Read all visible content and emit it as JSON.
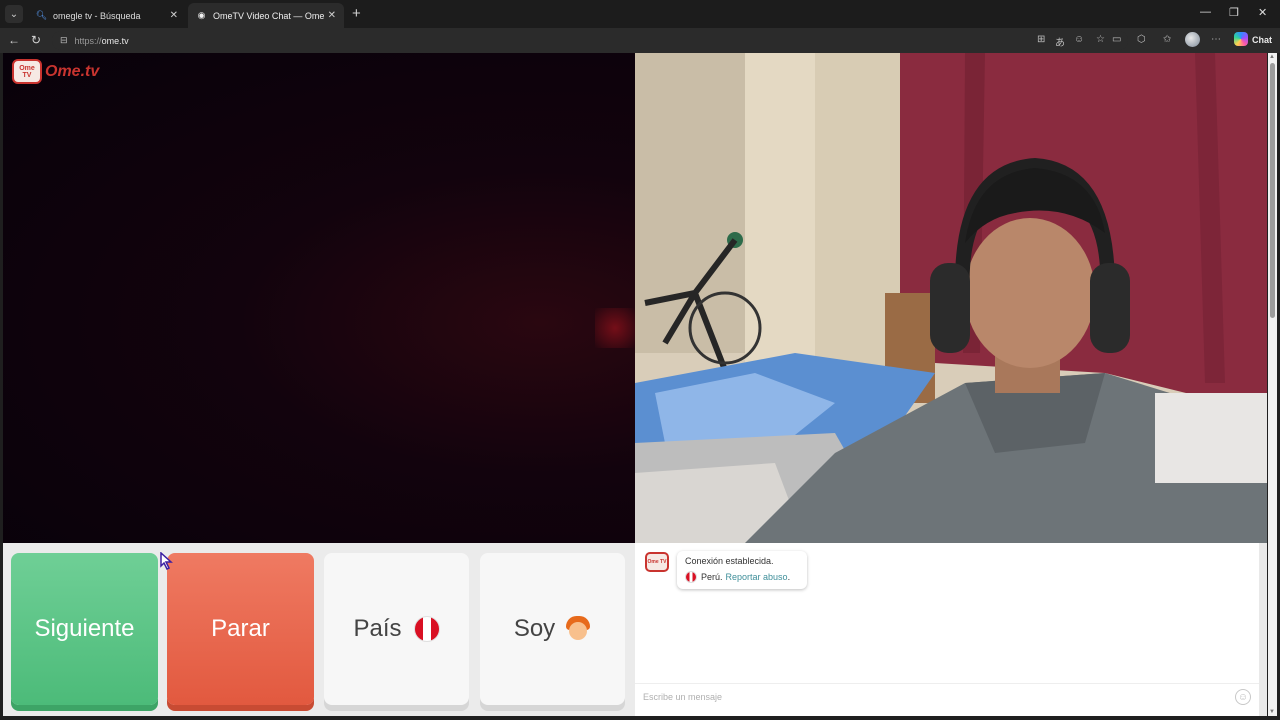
{
  "browser": {
    "tabs": [
      {
        "title": "omegle tv - Búsqueda",
        "favicon": "search-icon",
        "active": false
      },
      {
        "title": "OmeTV Video Chat — Omegle",
        "favicon": "globe-icon",
        "active": true
      }
    ],
    "url_protocol": "https://",
    "url_host": "ome.tv",
    "chat_label": "Chat"
  },
  "page": {
    "logo": {
      "badge": "Ome TV",
      "text": "Ome.tv"
    },
    "controls": {
      "next_label": "Siguiente",
      "stop_label": "Parar",
      "country_label": "País",
      "country_flag": "peru-flag-icon",
      "gender_label": "Soy",
      "gender_icon": "boy-icon"
    },
    "chat": {
      "status": "Conexión establecida.",
      "country": "Perú.",
      "report_link": "Reportar abuso",
      "report_suffix": ".",
      "input_placeholder": "Escribe un mensaje"
    }
  },
  "colors": {
    "next_button": "#4cbb79",
    "stop_button": "#e2593f",
    "brand_red": "#c9342f",
    "link": "#3f8f9a"
  }
}
